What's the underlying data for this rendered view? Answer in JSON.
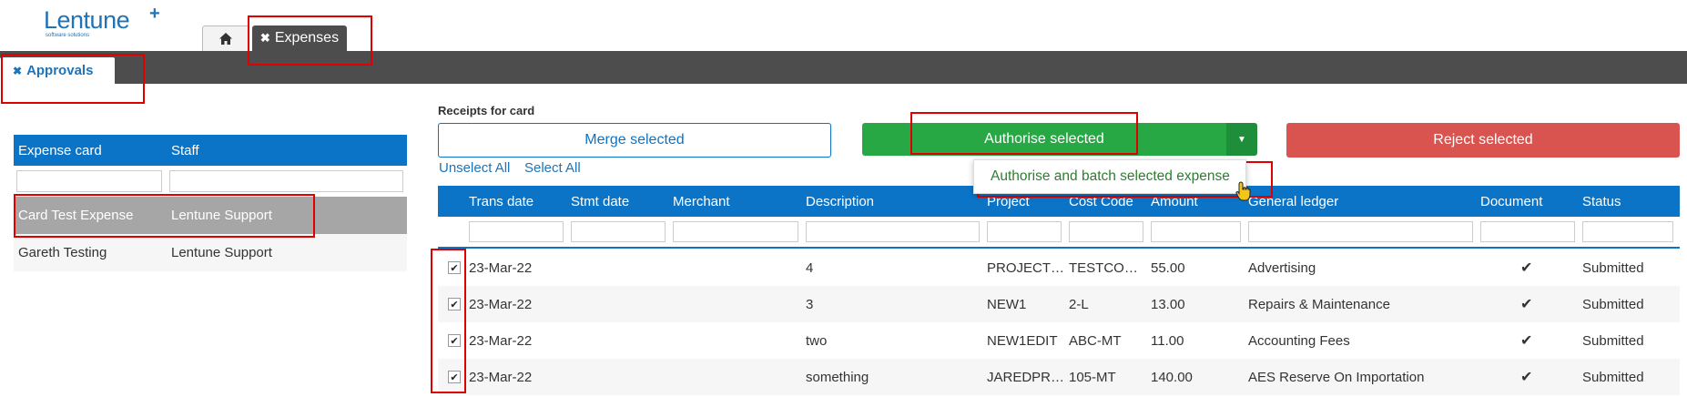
{
  "header": {
    "logo_name": "Lentune",
    "logo_plus": "+",
    "logo_sub": "software solutions",
    "tabs": [
      {
        "label": "",
        "icon": "home-icon"
      },
      {
        "label": "Expenses",
        "close_icon": "✖"
      }
    ],
    "subtab": {
      "label": "Approvals",
      "close_icon": "✖"
    }
  },
  "colors": {
    "brand_blue": "#0b74c7",
    "authorise_green": "#28a745",
    "reject_red": "#d9534f",
    "dark_bar": "#4d4d4d"
  },
  "left_table": {
    "columns": [
      "Expense card",
      "Staff"
    ],
    "rows": [
      {
        "card": "Card Test Expense",
        "staff": "Lentune Support"
      },
      {
        "card": "Gareth Testing",
        "staff": "Lentune Support"
      }
    ]
  },
  "receipts": {
    "label": "Receipts for card",
    "merge_label": "Merge selected",
    "authorise_label": "Authorise selected",
    "caret": "▼",
    "reject_label": "Reject selected",
    "unselect_all": "Unselect All",
    "select_all": "Select All",
    "dropdown_item": "Authorise and batch selected expense"
  },
  "grid": {
    "columns": [
      "Trans date",
      "Stmt date",
      "Merchant",
      "Description",
      "Project",
      "Cost Code",
      "Amount",
      "General ledger",
      "Document",
      "Status"
    ],
    "rows": [
      {
        "checked": "✔",
        "trans_date": "23-Mar-22",
        "stmt_date": "",
        "merchant": "",
        "description": "4",
        "project": "PROJECT…",
        "cost_code": "TESTCO…",
        "amount": "55.00",
        "ledger": "Advertising",
        "document": "✔",
        "status": "Submitted"
      },
      {
        "checked": "✔",
        "trans_date": "23-Mar-22",
        "stmt_date": "",
        "merchant": "",
        "description": "3",
        "project": "NEW1",
        "cost_code": "2-L",
        "amount": "13.00",
        "ledger": "Repairs & Maintenance",
        "document": "✔",
        "status": "Submitted"
      },
      {
        "checked": "✔",
        "trans_date": "23-Mar-22",
        "stmt_date": "",
        "merchant": "",
        "description": "two",
        "project": "NEW1EDIT",
        "cost_code": "ABC-MT",
        "amount": "11.00",
        "ledger": "Accounting Fees",
        "document": "✔",
        "status": "Submitted"
      },
      {
        "checked": "✔",
        "trans_date": "23-Mar-22",
        "stmt_date": "",
        "merchant": "",
        "description": "something",
        "project": "JAREDPR…",
        "cost_code": "105-MT",
        "amount": "140.00",
        "ledger": "AES Reserve On Importation",
        "document": "✔",
        "status": "Submitted"
      }
    ]
  }
}
